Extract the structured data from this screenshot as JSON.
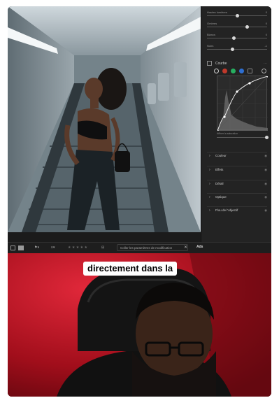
{
  "panel": {
    "sliders": [
      {
        "label": "Hautes lumières",
        "value": "0",
        "level": 0.5
      },
      {
        "label": "Ombres",
        "value": "0",
        "level": 0.68
      },
      {
        "label": "Blancs",
        "value": "0",
        "level": 0.45
      },
      {
        "label": "Noirs",
        "value": "-1",
        "level": 0.42
      }
    ],
    "curve_title": "Courbe",
    "curve_footer": "Affiner la saturation",
    "sections": [
      "Couleur",
      "Effets",
      "Détail",
      "Optique",
      "Flou de l'objectif"
    ]
  },
  "filmstrip": {
    "filter_placeholder": "Coller les paramètres de modification",
    "stars": "★ ★ ★ ★ ★",
    "clear": "✕",
    "trailing": "Ads"
  },
  "caption": {
    "text": "directement dans la"
  },
  "colors": {
    "cam_red": "#b3121e",
    "panel_bg": "#232323",
    "caption_bg": "#ffffff"
  }
}
